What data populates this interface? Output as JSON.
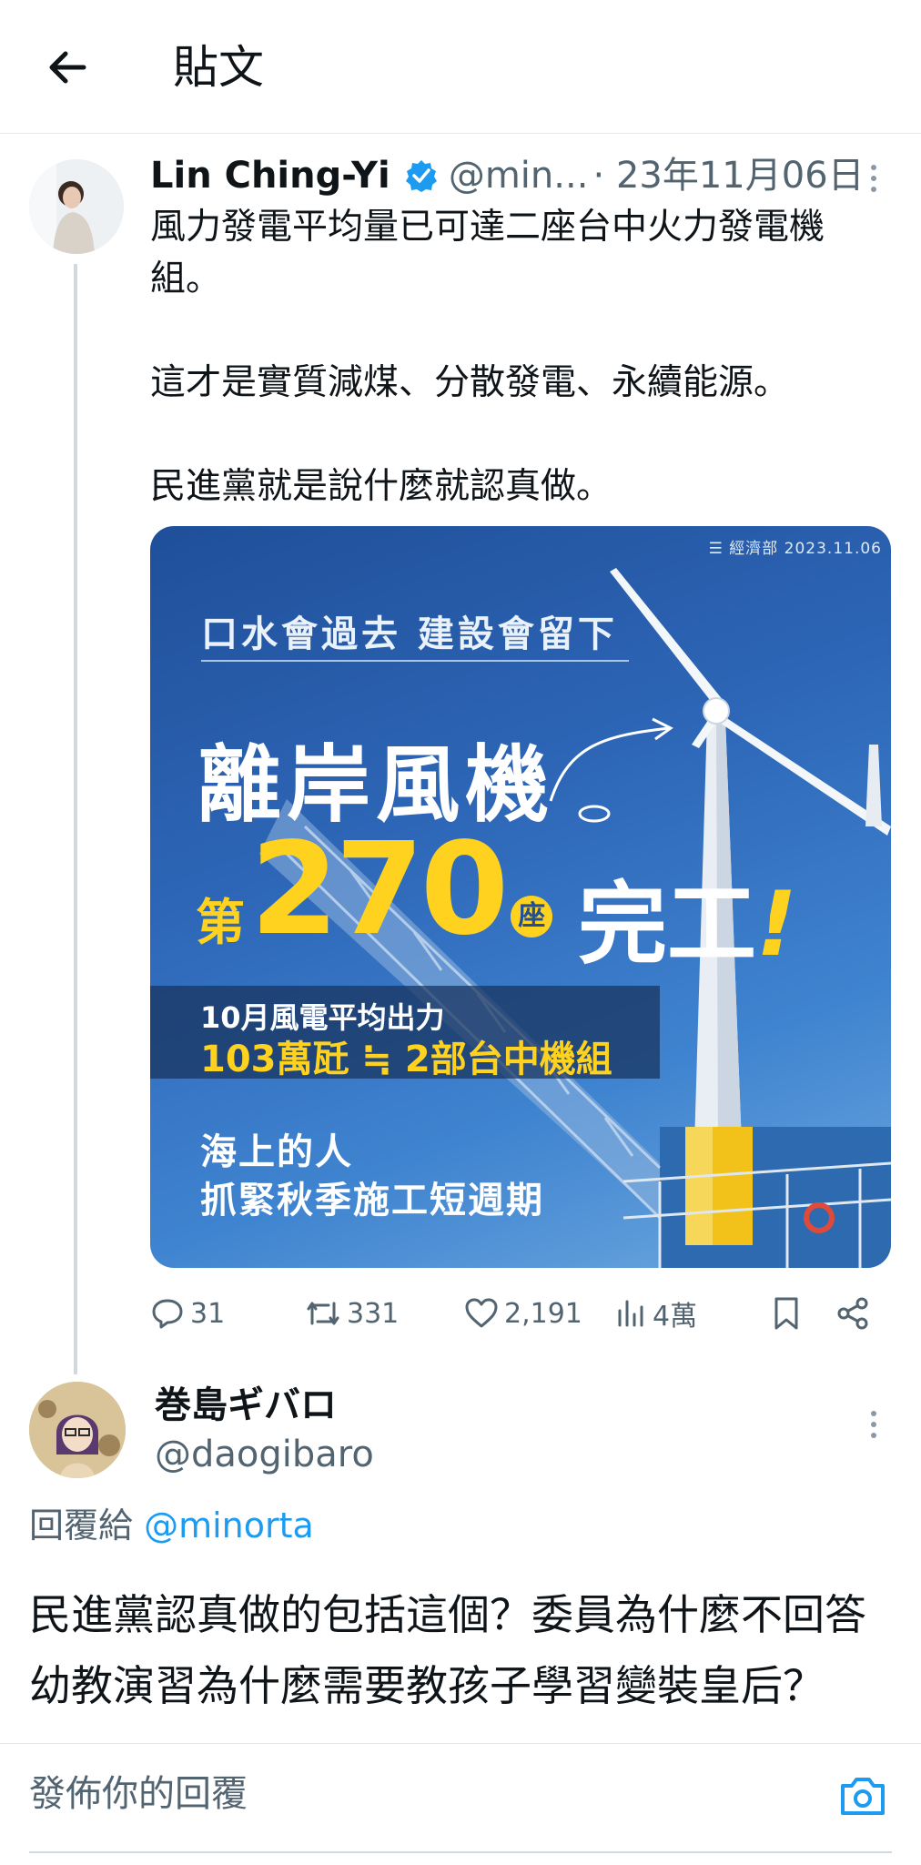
{
  "header": {
    "back_icon": "arrow-left-icon",
    "title": "貼文"
  },
  "tweet": {
    "display_name": "Lin Ching-Yi",
    "handle": "@min...",
    "date": "· 23年11月06日",
    "text": "風力發電平均量已可達二座台中火力發電機組。\n\n這才是實質減煤、分散發電、永續能源。\n\n民進黨就是說什麼就認真做。",
    "media": {
      "source": "☰ 經濟部 2023.11.06",
      "slogan": "口水會過去  建設會留下",
      "title": "離岸風機",
      "count_prefix": "第",
      "count_number": "270",
      "count_unit": "座",
      "done": "完工",
      "done_mark": "!",
      "band_line1": "10月風電平均出力",
      "band_line2": "103萬瓩 ≒ 2部台中機組",
      "footer_line1": "海上的人",
      "footer_line2": "抓緊秋季施工短週期"
    },
    "stats": {
      "replies": "31",
      "retweets": "331",
      "likes": "2,191",
      "views": "4萬"
    }
  },
  "reply": {
    "display_name": "巻島ギバロ",
    "handle": "@daogibaro",
    "reply_to_prefix": "回覆給 ",
    "reply_to_mention": "@minorta",
    "text": "民進黨認真做的包括這個？委員為什麼不回答幼教演習為什麼需要教孩子學習變裝皇后？"
  },
  "composer": {
    "placeholder": "發佈你的回覆"
  },
  "colors": {
    "accent": "#1d9bf0",
    "muted": "#536471",
    "highlight": "#ffd21f"
  }
}
